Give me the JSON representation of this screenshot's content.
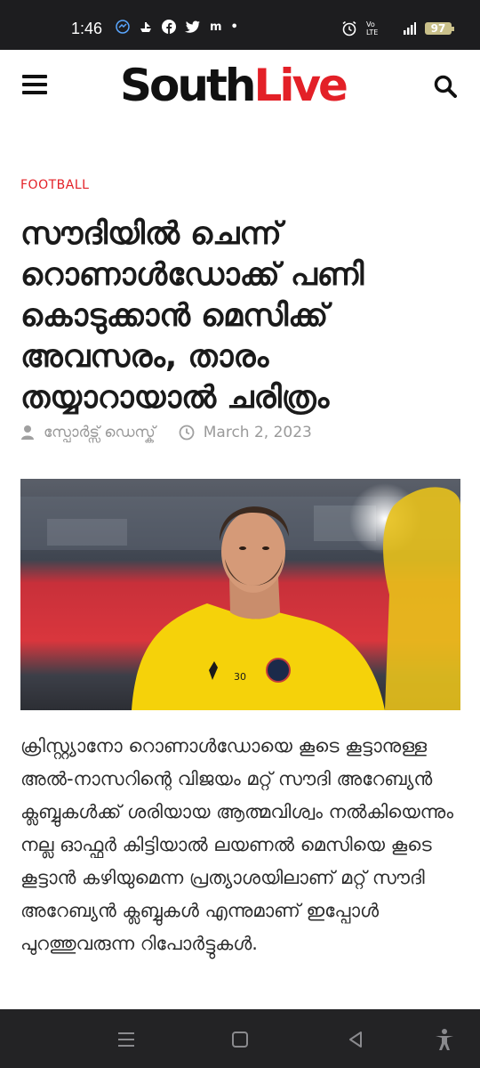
{
  "status_bar": {
    "time": "1:46",
    "battery": "97",
    "network": "4G",
    "network_label": "Vo LTE"
  },
  "header": {
    "logo_part1": "South",
    "logo_part2": "Live"
  },
  "article": {
    "category": "FOOTBALL",
    "headline": "സൗദിയിൽ ചെന്ന് റൊണാൾഡോക്ക് പണി കൊടുക്കാൻ മെസിക്ക് അവസരം, താരം തയ്യാറായാൽ ചരിത്രം",
    "author": "സ്പോർട്സ് ഡെസ്ക്",
    "date": "March 2, 2023",
    "body": "ക്രിസ്റ്റ്യാനോ റൊണാൾഡോയെ കൂടെ കൂട്ടാനുള്ള അൽ-നാസറിന്റെ വിജയം മറ്റ് സൗദി അറേബ്യൻ ക്ലബ്ബുകൾക്ക് ശരിയായ ആത്മവിശ്വം നൽകിയെന്നും നല്ല ഓഫ്ഫർ കിട്ടിയാൽ ലയണൽ മെസിയെ കൂടെ കൂട്ടാൻ കഴിയുമെന്ന പ്രത്യാശയിലാണ് മറ്റ് സൗദി അറേബ്യൻ ക്ലബ്ബുകൾ എന്നുമാണ് ഇപ്പോൾ പുറത്തുവരുന്ന റിപോർട്ടുകൾ.",
    "jersey_number": "30"
  },
  "colors": {
    "accent": "#e32027",
    "jersey": "#f5d20a"
  }
}
